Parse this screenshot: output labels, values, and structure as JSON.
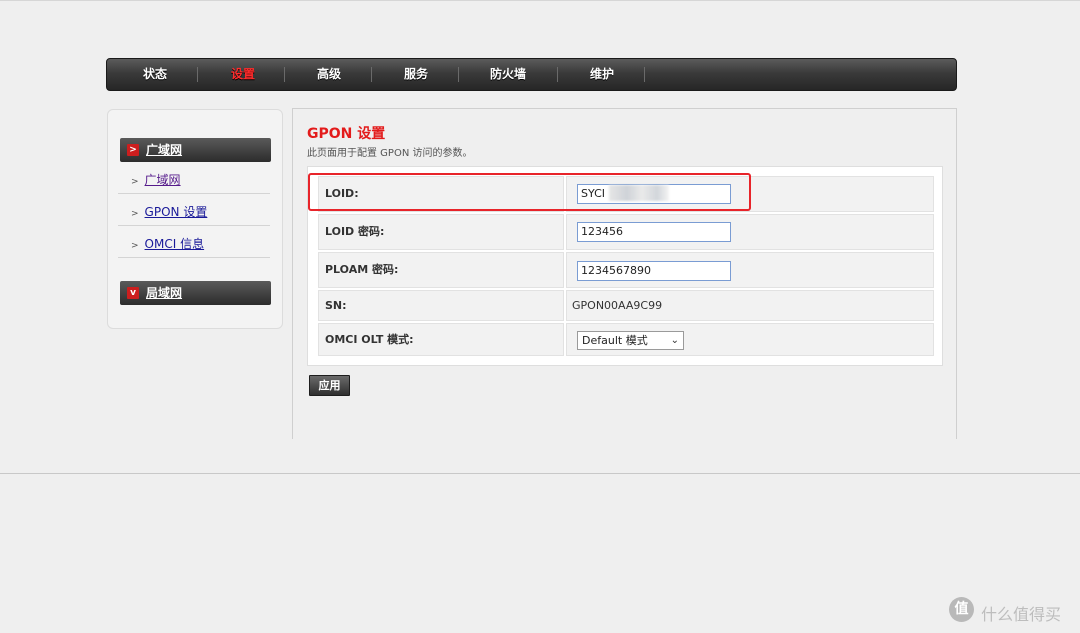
{
  "nav": {
    "items": [
      {
        "label": "状态"
      },
      {
        "label": "设置"
      },
      {
        "label": "高级"
      },
      {
        "label": "服务"
      },
      {
        "label": "防火墙"
      },
      {
        "label": "维护"
      }
    ],
    "active_color": "#ff2b2b"
  },
  "sidebar": {
    "sections": [
      {
        "label": "广域网",
        "badge": ">"
      },
      {
        "label": "局域网",
        "badge": "v"
      }
    ],
    "links": [
      {
        "label": "广域网"
      },
      {
        "label": "GPON 设置"
      },
      {
        "label": "OMCI 信息"
      }
    ]
  },
  "main": {
    "title": "GPON 设置",
    "description": "此页面用于配置 GPON 访问的参数。",
    "fields": {
      "loid": {
        "label": "LOID:",
        "value": "SYCI"
      },
      "loid_password": {
        "label": "LOID 密码:",
        "value": "123456"
      },
      "ploam_password": {
        "label": "PLOAM 密码:",
        "value": "1234567890"
      },
      "sn": {
        "label": "SN:",
        "value": "GPON00AA9C99"
      },
      "omci_mode": {
        "label": "OMCI OLT 模式:",
        "value": "Default 模式"
      }
    },
    "apply_label": "应用",
    "accent_color": "#e31b1b"
  },
  "watermark": {
    "glyph": "值",
    "text": "什么值得买"
  }
}
